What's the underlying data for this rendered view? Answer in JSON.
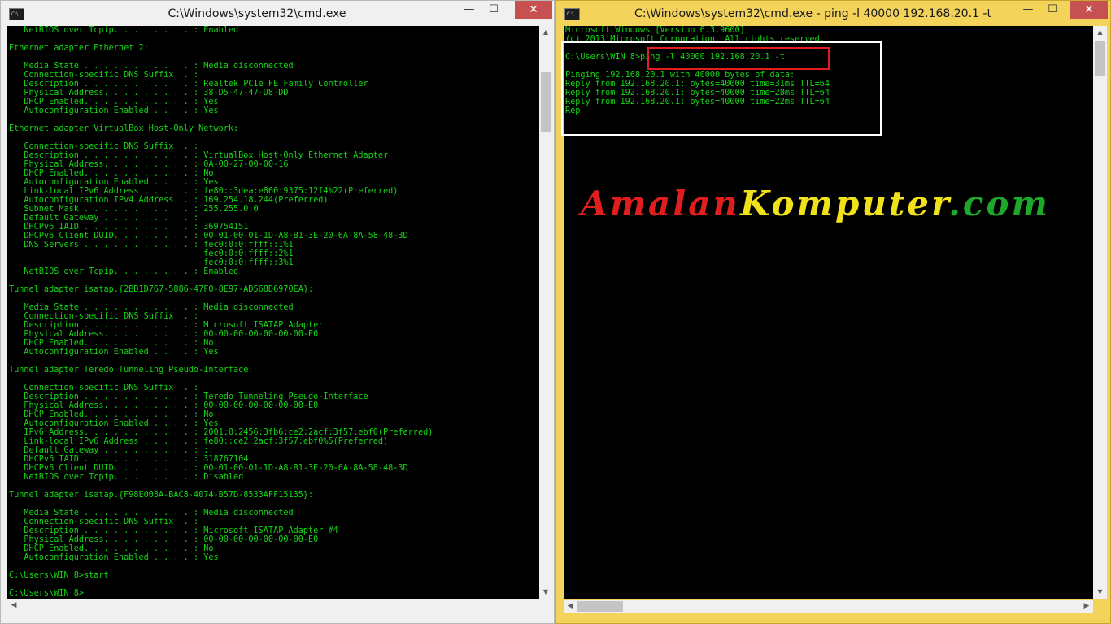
{
  "left_window": {
    "title": "C:\\Windows\\system32\\cmd.exe",
    "icon_label": "C:\\",
    "minimize": "—",
    "maximize": "☐",
    "close": "✕",
    "console_lines": [
      "   NetBIOS over Tcpip. . . . . . . . : Enabled",
      "",
      "Ethernet adapter Ethernet 2:",
      "",
      "   Media State . . . . . . . . . . . : Media disconnected",
      "   Connection-specific DNS Suffix  . :",
      "   Description . . . . . . . . . . . : Realtek PCIe FE Family Controller",
      "   Physical Address. . . . . . . . . : 38-D5-47-47-D8-DD",
      "   DHCP Enabled. . . . . . . . . . . : Yes",
      "   Autoconfiguration Enabled . . . . : Yes",
      "",
      "Ethernet adapter VirtualBox Host-Only Network:",
      "",
      "   Connection-specific DNS Suffix  . :",
      "   Description . . . . . . . . . . . : VirtualBox Host-Only Ethernet Adapter",
      "   Physical Address. . . . . . . . . : 0A-00-27-00-00-16",
      "   DHCP Enabled. . . . . . . . . . . : No",
      "   Autoconfiguration Enabled . . . . : Yes",
      "   Link-local IPv6 Address . . . . . : fe80::3dea:e860:9375:12f4%22(Preferred)",
      "   Autoconfiguration IPv4 Address. . : 169.254.18.244(Preferred)",
      "   Subnet Mask . . . . . . . . . . . : 255.255.0.0",
      "   Default Gateway . . . . . . . . . :",
      "   DHCPv6 IAID . . . . . . . . . . . : 369754151",
      "   DHCPv6 Client DUID. . . . . . . . : 00-01-00-01-1D-A8-B1-3E-20-6A-8A-58-48-3D",
      "   DNS Servers . . . . . . . . . . . : fec0:0:0:ffff::1%1",
      "                                       fec0:0:0:ffff::2%1",
      "                                       fec0:0:0:ffff::3%1",
      "   NetBIOS over Tcpip. . . . . . . . : Enabled",
      "",
      "Tunnel adapter isatap.{2BD1D767-5886-47F0-8E97-AD568D6970EA}:",
      "",
      "   Media State . . . . . . . . . . . : Media disconnected",
      "   Connection-specific DNS Suffix  . :",
      "   Description . . . . . . . . . . . : Microsoft ISATAP Adapter",
      "   Physical Address. . . . . . . . . : 00-00-00-00-00-00-00-E0",
      "   DHCP Enabled. . . . . . . . . . . : No",
      "   Autoconfiguration Enabled . . . . : Yes",
      "",
      "Tunnel adapter Teredo Tunneling Pseudo-Interface:",
      "",
      "   Connection-specific DNS Suffix  . :",
      "   Description . . . . . . . . . . . : Teredo Tunneling Pseudo-Interface",
      "   Physical Address. . . . . . . . . : 00-00-00-00-00-00-00-E0",
      "   DHCP Enabled. . . . . . . . . . . : No",
      "   Autoconfiguration Enabled . . . . : Yes",
      "   IPv6 Address. . . . . . . . . . . : 2001:0:2456:3fb6:ce2:2acf:3f57:ebf0(Preferred)",
      "   Link-local IPv6 Address . . . . . : fe80::ce2:2acf:3f57:ebf0%5(Preferred)",
      "   Default Gateway . . . . . . . . . : ::",
      "   DHCPv6 IAID . . . . . . . . . . . : 318767104",
      "   DHCPv6 Client DUID. . . . . . . . : 00-01-00-01-1D-A8-B1-3E-20-6A-8A-58-48-3D",
      "   NetBIOS over Tcpip. . . . . . . . : Disabled",
      "",
      "Tunnel adapter isatap.{F98E003A-BAC8-4074-B57D-8533AFF15135}:",
      "",
      "   Media State . . . . . . . . . . . : Media disconnected",
      "   Connection-specific DNS Suffix  . :",
      "   Description . . . . . . . . . . . : Microsoft ISATAP Adapter #4",
      "   Physical Address. . . . . . . . . : 00-00-00-00-00-00-00-E0",
      "   DHCP Enabled. . . . . . . . . . . : No",
      "   Autoconfiguration Enabled . . . . : Yes",
      "",
      "C:\\Users\\WIN 8>start",
      "",
      "C:\\Users\\WIN 8>"
    ]
  },
  "right_window": {
    "title": "C:\\Windows\\system32\\cmd.exe - ping  -l 40000 192.168.20.1 -t",
    "icon_label": "C:\\",
    "minimize": "—",
    "maximize": "☐",
    "close": "✕",
    "console_lines": [
      "Microsoft Windows [Version 6.3.9600]",
      "(c) 2013 Microsoft Corporation. All rights reserved.",
      "",
      "C:\\Users\\WIN 8>ping -l 40000 192.168.20.1 -t",
      "",
      "Pinging 192.168.20.1 with 40000 bytes of data:",
      "Reply from 192.168.20.1: bytes=40000 time=31ms TTL=64",
      "Reply from 192.168.20.1: bytes=40000 time=28ms TTL=64",
      "Reply from 192.168.20.1: bytes=40000 time=22ms TTL=64",
      "Rep"
    ]
  },
  "watermark": {
    "part1": "Amalan",
    "part2": "Komputer",
    "part3": ".com"
  },
  "colors": {
    "console_bg": "#000000",
    "console_text": "#14d514",
    "active_title_bg": "#f4d35a",
    "highlight_outer": "#ffffff",
    "highlight_inner": "#e21d1d",
    "close_button": "#c75050"
  }
}
